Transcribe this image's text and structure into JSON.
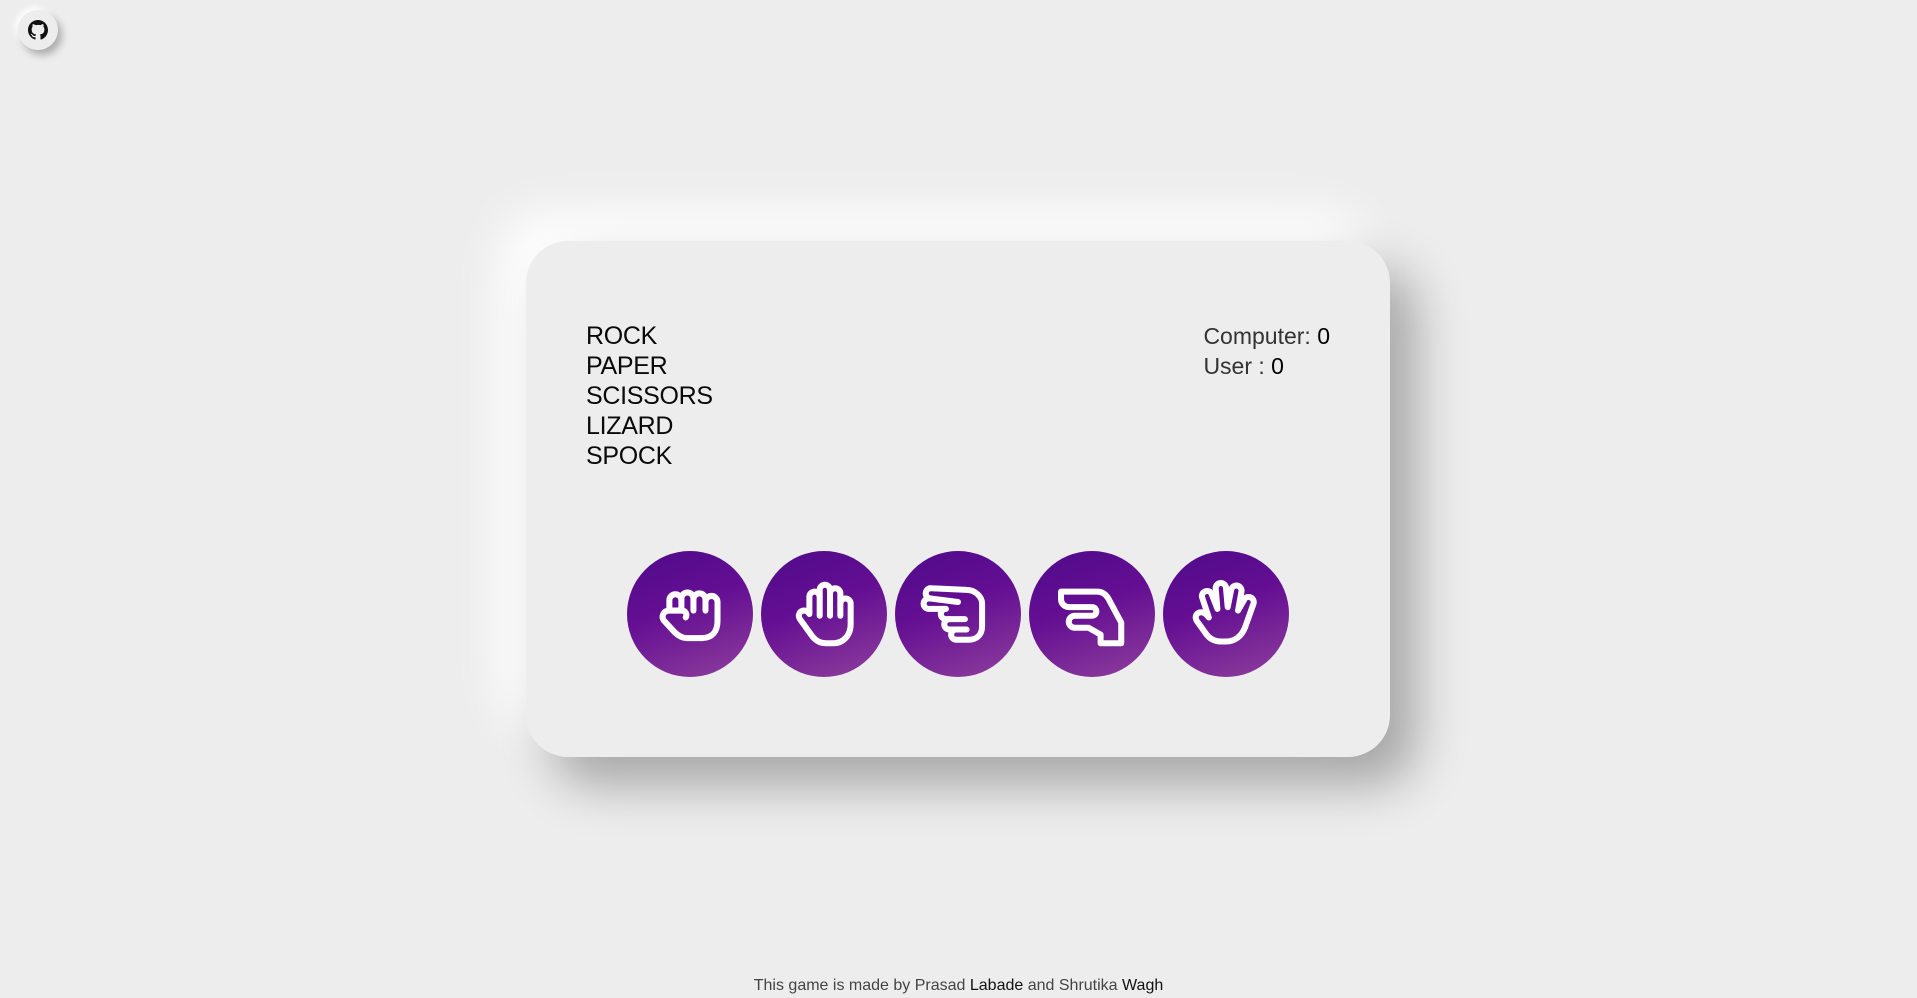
{
  "header": {
    "github_icon": "github-icon"
  },
  "game": {
    "title_lines": [
      "ROCK",
      "PAPER",
      "SCISSORS",
      "LIZARD",
      "SPOCK"
    ],
    "score": {
      "computer_label": "Computer:",
      "computer_value": "0",
      "user_label": "User :",
      "user_value": "0"
    },
    "choices": [
      {
        "name": "rock",
        "icon": "hand-rock-icon"
      },
      {
        "name": "paper",
        "icon": "hand-paper-icon"
      },
      {
        "name": "scissors",
        "icon": "hand-scissors-icon"
      },
      {
        "name": "lizard",
        "icon": "hand-lizard-icon"
      },
      {
        "name": "spock",
        "icon": "hand-spock-icon"
      }
    ],
    "colors": {
      "button_gradient_start": "#4f0a8a",
      "button_gradient_end": "#8f3f9c",
      "background": "#ededed"
    }
  },
  "footer": {
    "prefix": "This game is made by",
    "author1_first": "Prasad",
    "author1_last": "Labade",
    "joiner": "and",
    "author2_first": "Shrutika",
    "author2_last": "Wagh"
  }
}
